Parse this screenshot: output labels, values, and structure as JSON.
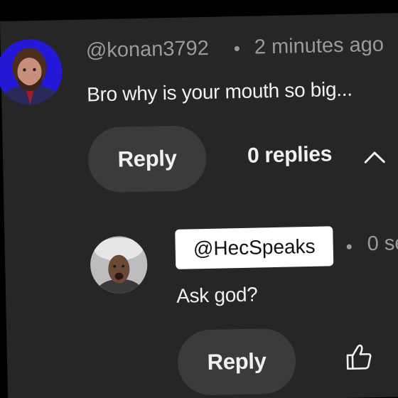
{
  "comment": {
    "author": "@konan3792",
    "separator": "•",
    "time": "2 minutes ago",
    "text": "Bro why is your mouth so big...",
    "reply_label": "Reply",
    "replies_label": "0 replies",
    "replies_toggle_icon": "chevron-up-icon"
  },
  "reply": {
    "author": "@HecSpeaks",
    "separator": "•",
    "time": "0 se",
    "text": "Ask god?",
    "reply_label": "Reply",
    "like_icon": "thumbs-up-icon"
  },
  "colors": {
    "panel_bg": "#262626",
    "button_bg": "#3b3b3b",
    "text_primary": "#f1f1f1",
    "text_secondary": "#9a9a9a",
    "author_chip_bg": "#ffffff"
  }
}
